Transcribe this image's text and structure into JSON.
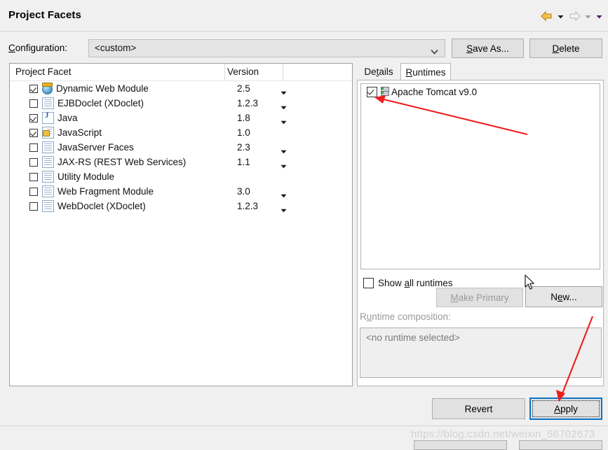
{
  "window": {
    "title": "Project Facets",
    "nav": {
      "back_icon": "back-arrow-icon",
      "back_menu_icon": "chevron-down-icon",
      "forward_icon": "forward-arrow-icon",
      "forward_menu_icon": "chevron-down-icon",
      "extra_menu_icon": "chevron-down-icon"
    }
  },
  "configuration": {
    "label": "Configuration:",
    "label_mnemonic": "C",
    "label_rest": "onfiguration:",
    "value": "<custom>",
    "dropdown_icon": "chevron-down-icon",
    "save_as_mnemonic": "S",
    "save_as_rest": "ave As...",
    "delete_mnemonic": "D",
    "delete_rest": "elete"
  },
  "facets_table": {
    "columns": [
      "Project Facet",
      "Version"
    ],
    "rows": [
      {
        "checked": true,
        "icon": "globe-icon",
        "name": "Dynamic Web Module",
        "version": "2.5",
        "has_caret": true
      },
      {
        "checked": false,
        "icon": "document-icon",
        "name": "EJBDoclet (XDoclet)",
        "version": "1.2.3",
        "has_caret": true
      },
      {
        "checked": true,
        "icon": "java-icon",
        "name": "Java",
        "version": "1.8",
        "has_caret": true
      },
      {
        "checked": true,
        "icon": "javascript-icon",
        "name": "JavaScript",
        "version": "1.0",
        "has_caret": false
      },
      {
        "checked": false,
        "icon": "document-icon",
        "name": "JavaServer Faces",
        "version": "2.3",
        "has_caret": true
      },
      {
        "checked": false,
        "icon": "document-icon",
        "name": "JAX-RS (REST Web Services)",
        "version": "1.1",
        "has_caret": true
      },
      {
        "checked": false,
        "icon": "document-icon",
        "name": "Utility Module",
        "version": "",
        "has_caret": false
      },
      {
        "checked": false,
        "icon": "document-icon",
        "name": "Web Fragment Module",
        "version": "3.0",
        "has_caret": true
      },
      {
        "checked": false,
        "icon": "document-icon",
        "name": "WebDoclet (XDoclet)",
        "version": "1.2.3",
        "has_caret": true
      }
    ]
  },
  "right_panel": {
    "tabs": [
      {
        "label": "Details",
        "mnemonic_pre": "De",
        "mnemonic": "t",
        "mnemonic_post": "ails",
        "active": false
      },
      {
        "label": "Runtimes",
        "mnemonic_pre": "",
        "mnemonic": "R",
        "mnemonic_post": "untimes",
        "active": true
      }
    ],
    "runtimes": [
      {
        "checked": true,
        "icon": "server-icon",
        "name": "Apache Tomcat v9.0"
      }
    ],
    "show_all_runtimes": {
      "checked": false,
      "label_pre": "Show ",
      "mnemonic": "a",
      "label_post": "ll runtimes"
    },
    "make_primary": {
      "mnemonic": "M",
      "rest": "ake Primary",
      "enabled": false
    },
    "new_button": {
      "pre": "N",
      "mnemonic": "e",
      "post": "w...",
      "enabled": true
    },
    "runtime_composition": {
      "label_pre": "R",
      "mnemonic": "u",
      "label_post": "ntime composition:",
      "value": "<no runtime selected>",
      "enabled": false
    }
  },
  "footer": {
    "revert_label": "Revert",
    "apply_mnemonic": "A",
    "apply_rest": "pply"
  },
  "annotations": {
    "watermark": "https://blog.csdn.net/weixin_56702673",
    "arrow_color": "#ee1c1c",
    "focus_color": "#0a73c8",
    "cursor_icon": "mouse-pointer-icon"
  }
}
